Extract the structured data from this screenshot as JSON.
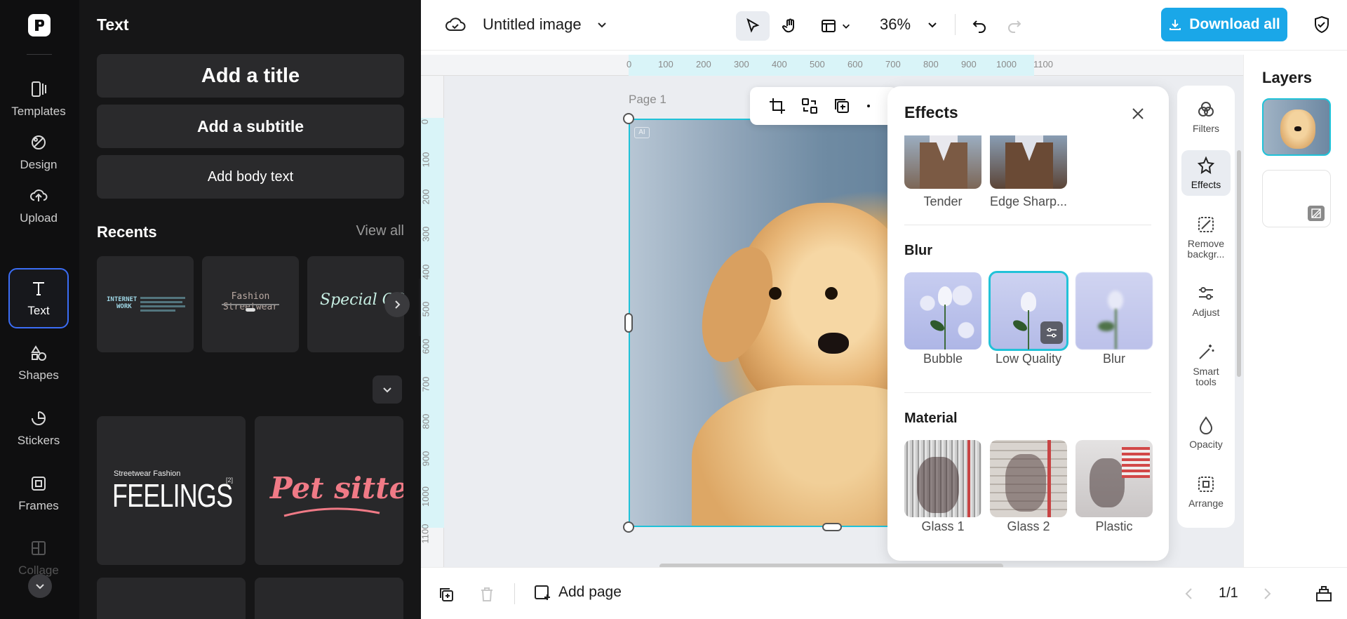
{
  "rail": {
    "items": [
      {
        "label": "Templates",
        "icon": "templates-icon"
      },
      {
        "label": "Design",
        "icon": "design-icon"
      },
      {
        "label": "Upload",
        "icon": "upload-icon"
      },
      {
        "label": "Text",
        "icon": "text-icon"
      },
      {
        "label": "Shapes",
        "icon": "shapes-icon"
      },
      {
        "label": "Stickers",
        "icon": "stickers-icon"
      },
      {
        "label": "Frames",
        "icon": "frames-icon"
      },
      {
        "label": "Collage",
        "icon": "collage-icon"
      }
    ],
    "active": "Text"
  },
  "panel": {
    "title": "Text",
    "add_title": "Add a title",
    "add_subtitle": "Add a subtitle",
    "add_body": "Add body text",
    "recents_title": "Recents",
    "view_all": "View all",
    "recents": [
      {
        "line1": "INTERNET",
        "line2": "WORK"
      },
      {
        "line1": "Fashion Streetwear"
      },
      {
        "line1": "Special Offe"
      }
    ],
    "templates": [
      {
        "small": "Streetwear Fashion",
        "big": "FEELINGS",
        "sup": "[2]"
      },
      {
        "big": "Pet sitter"
      }
    ]
  },
  "topbar": {
    "doc_name": "Untitled image",
    "zoom": "36%",
    "download_label": "Download all"
  },
  "canvas": {
    "page_label": "Page 1",
    "ruler_h": [
      "0",
      "100",
      "200",
      "300",
      "400",
      "500",
      "600",
      "700",
      "800",
      "900",
      "1000",
      "1100"
    ],
    "ruler_v": [
      "0",
      "100",
      "200",
      "300",
      "400",
      "500",
      "600",
      "700",
      "800",
      "900",
      "1000",
      "1100"
    ],
    "ai_badge": "AI"
  },
  "effects": {
    "title": "Effects",
    "top_items": [
      "Tender",
      "Edge Sharp..."
    ],
    "sections": [
      {
        "title": "Blur",
        "items": [
          "Bubble",
          "Low Quality",
          "Blur"
        ],
        "selected": "Low Quality"
      },
      {
        "title": "Material",
        "items": [
          "Glass 1",
          "Glass 2",
          "Plastic"
        ]
      }
    ]
  },
  "tool_strip": {
    "items": [
      {
        "label": "Filters",
        "icon": "filters-icon"
      },
      {
        "label": "Effects",
        "icon": "effects-icon"
      },
      {
        "label": "Remove backgr...",
        "icon": "remove-background-icon"
      },
      {
        "label": "Adjust",
        "icon": "adjust-icon"
      },
      {
        "label": "Smart tools",
        "icon": "smart-tools-icon"
      },
      {
        "label": "Opacity",
        "icon": "opacity-icon"
      },
      {
        "label": "Arrange",
        "icon": "arrange-icon"
      }
    ],
    "active": "Effects"
  },
  "layers": {
    "title": "Layers"
  },
  "bottombar": {
    "add_page": "Add page",
    "page_indicator": "1/1"
  },
  "colors": {
    "accent": "#1aa7e8",
    "selection": "#1fc2d8",
    "rail_active": "#3b6df5"
  }
}
